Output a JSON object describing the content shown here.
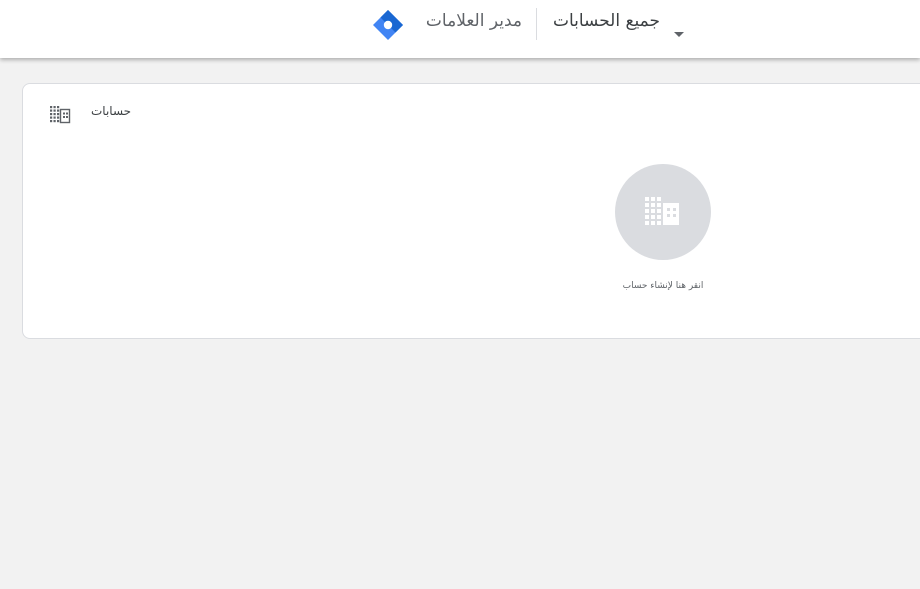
{
  "header": {
    "product_name": "مدير العلامات",
    "account_switcher_label": "جميع الحسابات",
    "icons": {
      "logo": "tag-manager-logo-icon",
      "caret": "caret-down-icon"
    }
  },
  "accounts_card": {
    "title": "حسابات",
    "header_icon": "building-icon",
    "empty_state": {
      "icon": "building-icon",
      "text": "انقر هنا لإنشاء حساب"
    }
  },
  "colors": {
    "page_background": "#f2f2f2",
    "surface": "#ffffff",
    "logo_blue": "#4285f4",
    "logo_dark_blue": "#1967d2",
    "empty_circle": "#dadce0",
    "text_secondary": "#5f6368"
  }
}
